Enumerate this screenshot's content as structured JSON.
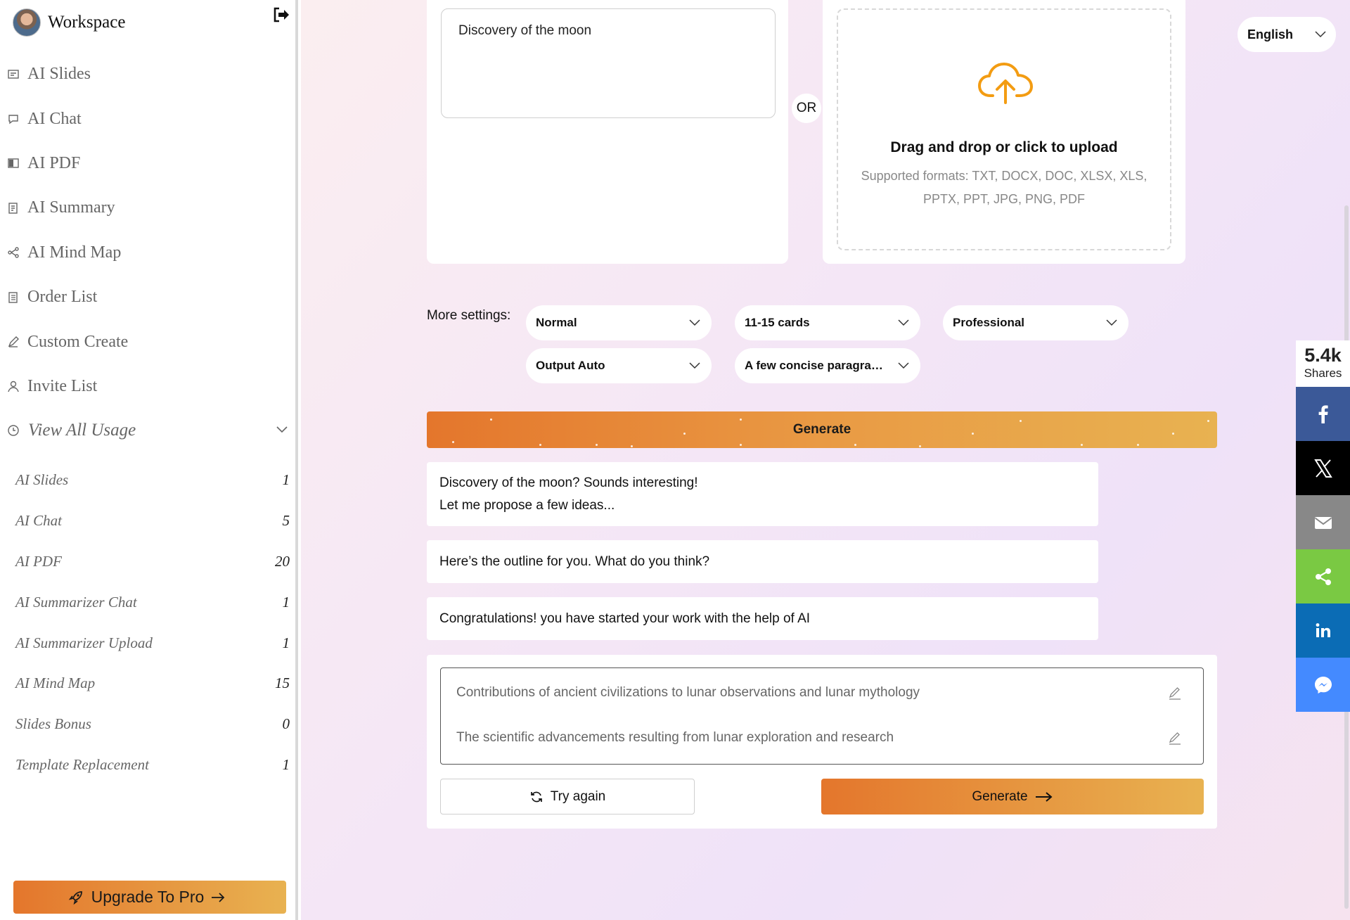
{
  "sidebar": {
    "workspace_title": "Workspace",
    "nav": [
      {
        "label": "AI Slides",
        "icon": "slides-icon"
      },
      {
        "label": "AI Chat",
        "icon": "chat-icon"
      },
      {
        "label": "AI PDF",
        "icon": "pdf-icon"
      },
      {
        "label": "AI Summary",
        "icon": "summary-icon"
      },
      {
        "label": "AI Mind Map",
        "icon": "mindmap-icon"
      },
      {
        "label": "Order List",
        "icon": "order-list-icon"
      },
      {
        "label": "Custom Create",
        "icon": "pencil-icon"
      },
      {
        "label": "Invite List",
        "icon": "user-icon"
      }
    ],
    "usage_header": "View All Usage",
    "usage": [
      {
        "label": "AI Slides",
        "value": "1"
      },
      {
        "label": "AI Chat",
        "value": "5"
      },
      {
        "label": "AI PDF",
        "value": "20"
      },
      {
        "label": "AI Summarizer Chat",
        "value": "1"
      },
      {
        "label": "AI Summarizer Upload",
        "value": "1"
      },
      {
        "label": "AI Mind Map",
        "value": "15"
      },
      {
        "label": "Slides Bonus",
        "value": "0"
      },
      {
        "label": "Template Replacement",
        "value": "1"
      }
    ],
    "upgrade_label": "Upgrade To Pro"
  },
  "main": {
    "topic_value": "Discovery of the moon",
    "or_label": "OR",
    "upload": {
      "title": "Drag and drop or click to upload",
      "formats": "Supported formats: TXT, DOCX, DOC, XLSX, XLS, PPTX, PPT, JPG, PNG, PDF"
    },
    "language": "English",
    "settings_label": "More settings:",
    "settings": {
      "mode": "Normal",
      "cards": "11-15 cards",
      "tone": "Professional",
      "output": "Output Auto",
      "text_amount": "A few concise paragraphs"
    },
    "generate_label": "Generate",
    "messages": [
      {
        "line1": "Discovery of the moon? Sounds interesting!",
        "line2": "Let me propose a few ideas..."
      },
      {
        "line1": "Here’s the outline for you. What do you think?"
      },
      {
        "line1": "Congratulations! you have started your work with the help of AI"
      }
    ],
    "outline": [
      "Contributions of ancient civilizations to lunar observations and lunar mythology",
      "The scientific advancements resulting from lunar exploration and research"
    ],
    "try_again_label": "Try again",
    "generate2_label": "Generate"
  },
  "share": {
    "count": "5.4k",
    "count_label": "Shares",
    "buttons": [
      {
        "name": "facebook",
        "color": "#3b5998"
      },
      {
        "name": "x",
        "color": "#000000"
      },
      {
        "name": "email",
        "color": "#888888"
      },
      {
        "name": "share",
        "color": "#7ac943"
      },
      {
        "name": "linkedin",
        "color": "#0b6cb5"
      },
      {
        "name": "messenger",
        "color": "#448aff"
      }
    ]
  },
  "colors": {
    "accent_start": "#e4762c",
    "accent_end": "#e8b251",
    "cloud_icon": "#f39c12"
  }
}
